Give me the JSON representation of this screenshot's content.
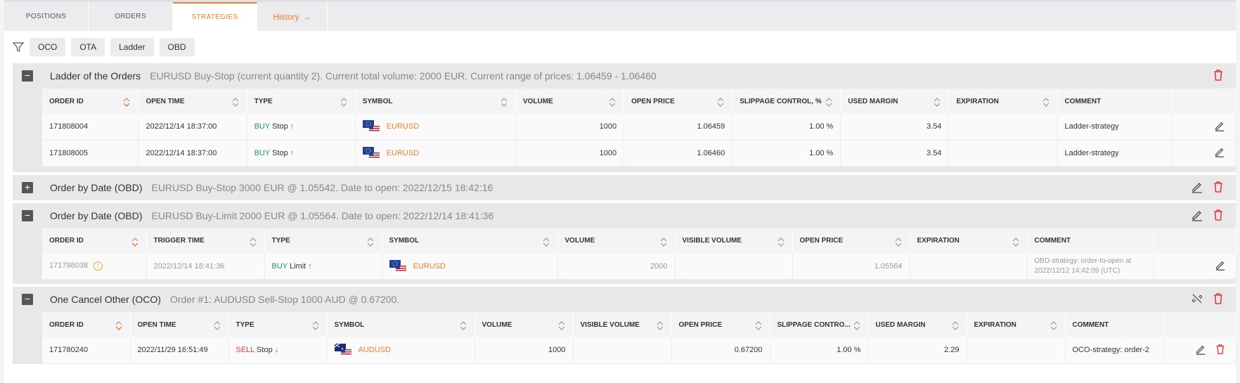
{
  "tabs": [
    {
      "label": "POSITIONS"
    },
    {
      "label": "ORDERS"
    },
    {
      "label": "STRATEGIES"
    },
    {
      "label": "History"
    }
  ],
  "filters": [
    "OCO",
    "OTA",
    "Ladder",
    "OBD"
  ],
  "colors": {
    "accent": "#f07e2a",
    "buy": "#1aa251",
    "sell": "#e23d3d",
    "delete": "#e23d3d"
  },
  "ladder": {
    "title": "Ladder of the Orders",
    "desc": "EURUSD Buy-Stop (current quantity 2). Current total volume: 2000 EUR. Current range of prices: 1.06459 - 1.06460",
    "columns": [
      "ORDER ID",
      "OPEN TIME",
      "TYPE",
      "SYMBOL",
      "VOLUME",
      "OPEN PRICE",
      "SLIPPAGE CONTROL, %",
      "USED MARGIN",
      "EXPIRATION",
      "COMMENT"
    ],
    "rows": [
      {
        "id": "171808004",
        "time": "2022/12/14 18:37:00",
        "side": "BUY",
        "kind": "Stop",
        "symbol": "EURUSD",
        "volume": "1000",
        "price": "1.06459",
        "slippage": "1.00 %",
        "margin": "3.54",
        "expiration": "",
        "comment": "Ladder-strategy"
      },
      {
        "id": "171808005",
        "time": "2022/12/14 18:37:00",
        "side": "BUY",
        "kind": "Stop",
        "symbol": "EURUSD",
        "volume": "1000",
        "price": "1.06460",
        "slippage": "1.00 %",
        "margin": "3.54",
        "expiration": "",
        "comment": "Ladder-strategy"
      }
    ]
  },
  "obd1": {
    "title": "Order by Date (OBD)",
    "desc": "EURUSD Buy-Stop 3000 EUR @ 1.05542. Date to open: 2022/12/15 18:42:16"
  },
  "obd2": {
    "title": "Order by Date (OBD)",
    "desc": "EURUSD Buy-Limit 2000 EUR @ 1.05564. Date to open: 2022/12/14 18:41:36",
    "columns": [
      "ORDER ID",
      "TRIGGER TIME",
      "TYPE",
      "SYMBOL",
      "VOLUME",
      "VISIBLE VOLUME",
      "OPEN PRICE",
      "EXPIRATION",
      "COMMENT"
    ],
    "row": {
      "id": "171798038",
      "time": "2022/12/14 18:41:36",
      "side": "BUY",
      "kind": "Limit",
      "symbol": "EURUSD",
      "volume": "2000",
      "visible": "",
      "price": "1.05564",
      "expiration": "",
      "comment1": "OBD-strategy: order-to-open at",
      "comment2": "2022/12/12 14:42:09 (UTC)"
    }
  },
  "oco": {
    "title": "One Cancel Other (OCO)",
    "desc": "Order #1: AUDUSD Sell-Stop 1000 AUD @ 0.67200.",
    "columns": [
      "ORDER ID",
      "OPEN TIME",
      "TYPE",
      "SYMBOL",
      "VOLUME",
      "VISIBLE VOLUME",
      "OPEN PRICE",
      "SLIPPAGE CONTRO...",
      "USED MARGIN",
      "EXPIRATION",
      "COMMENT"
    ],
    "row": {
      "id": "171780240",
      "time": "2022/11/29 16:51:49",
      "side": "SELL",
      "kind": "Stop",
      "symbol": "AUDUSD",
      "volume": "1000",
      "visible": "",
      "price": "0.67200",
      "slippage": "1.00 %",
      "margin": "2.29",
      "expiration": "",
      "comment": "OCO-strategy: order-2"
    }
  }
}
